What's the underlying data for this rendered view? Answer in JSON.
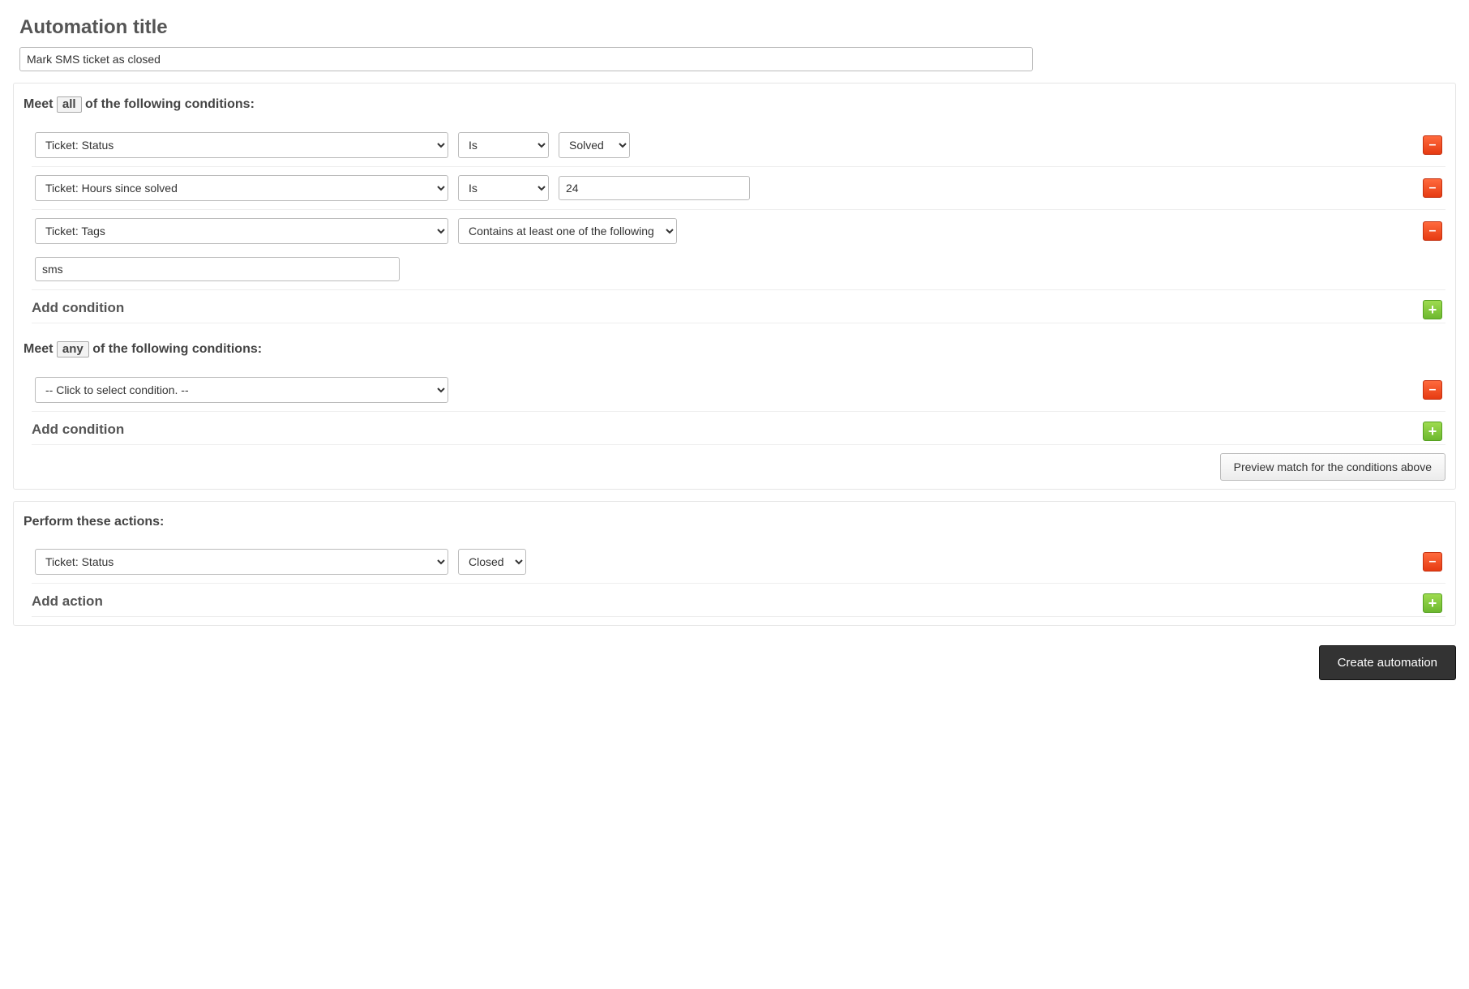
{
  "page": {
    "heading": "Automation title",
    "title_value": "Mark SMS ticket as closed"
  },
  "conditions_all": {
    "label_pre": "Meet",
    "badge": "all",
    "label_post": "of the following conditions:",
    "rows": [
      {
        "field": "Ticket: Status",
        "operator": "Is",
        "value": "Solved"
      },
      {
        "field": "Ticket: Hours since solved",
        "operator": "Is",
        "value_text": "24"
      },
      {
        "field": "Ticket: Tags",
        "operator_wide": "Contains at least one of the following",
        "tag_value": "sms"
      }
    ],
    "add_label": "Add condition"
  },
  "conditions_any": {
    "label_pre": "Meet",
    "badge": "any",
    "label_post": "of the following conditions:",
    "rows": [
      {
        "field": "-- Click to select condition. --"
      }
    ],
    "add_label": "Add condition"
  },
  "preview_button": "Preview match for the conditions above",
  "actions": {
    "heading": "Perform these actions:",
    "rows": [
      {
        "field": "Ticket: Status",
        "value": "Closed"
      }
    ],
    "add_label": "Add action"
  },
  "submit_button": "Create automation"
}
